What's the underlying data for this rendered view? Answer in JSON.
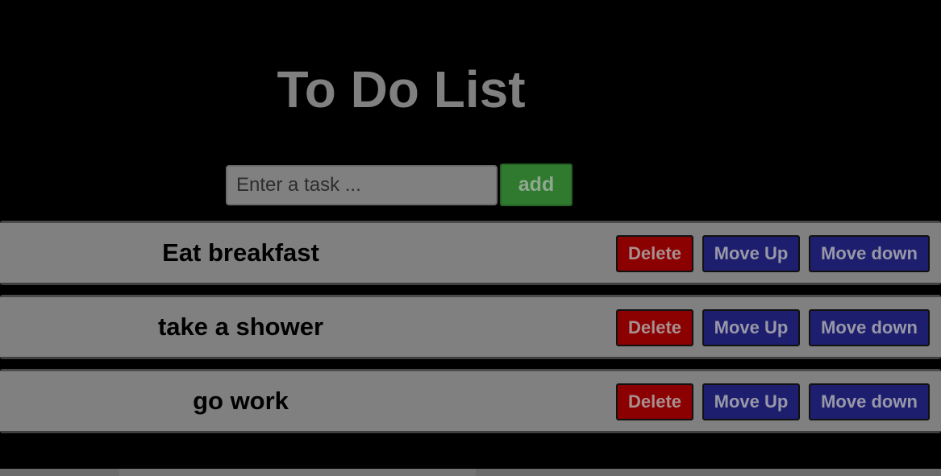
{
  "app": {
    "title": "To Do List"
  },
  "input": {
    "placeholder": "Enter a task ...",
    "value": ""
  },
  "add_button": {
    "label": "add"
  },
  "tasks": [
    {
      "text": "Eat breakfast",
      "delete_label": "Delete",
      "up_label": "Move Up",
      "down_label": "Move down"
    },
    {
      "text": "take a shower",
      "delete_label": "Delete",
      "up_label": "Move Up",
      "down_label": "Move down"
    },
    {
      "text": "go work",
      "delete_label": "Delete",
      "up_label": "Move Up",
      "down_label": "Move down"
    }
  ],
  "colors": {
    "background": "#000000",
    "row": "#808080",
    "add": "#2f7a2f",
    "delete": "#8b0000",
    "move": "#1e1e6e"
  }
}
